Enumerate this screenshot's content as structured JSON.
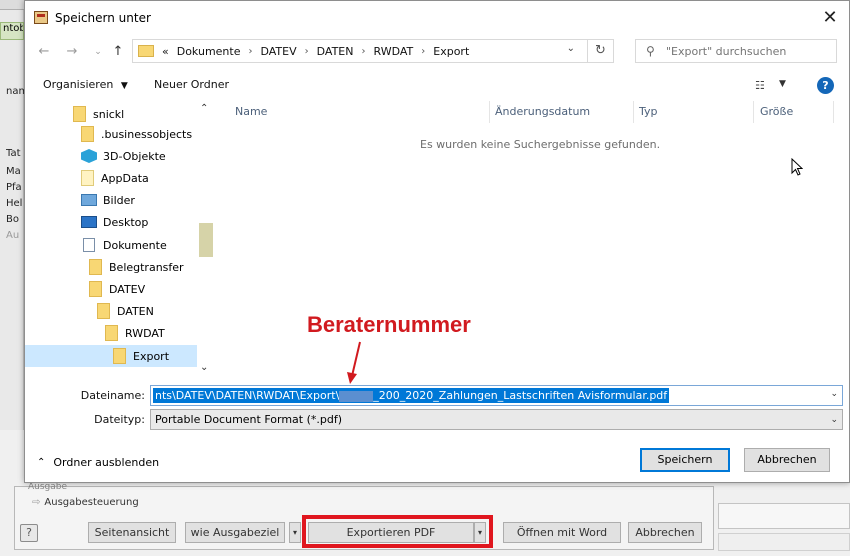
{
  "background": {
    "left_tab": "ntob",
    "left_labels": [
      "nam",
      "Tat",
      "Ma",
      "Pfa",
      "Hel",
      "Bo",
      "Au"
    ],
    "ausgabe_small": "Ausgabe",
    "ausgabesteuerung": "Ausgabesteuerung",
    "help_label": "?",
    "buttons": {
      "seitenansicht": "Seitenansicht",
      "wie_ausgabeziel": "wie Ausgabeziel",
      "exportieren_pdf": "Exportieren PDF",
      "oeffnen_mit_word": "Öffnen mit Word",
      "abbrechen": "Abbrechen"
    }
  },
  "dialog": {
    "title": "Speichern unter",
    "close_label": "✕",
    "address": {
      "prefix": "«",
      "crumbs": [
        "Dokumente",
        "DATEV",
        "DATEN",
        "RWDAT",
        "Export"
      ]
    },
    "search_placeholder": "\"Export\" durchsuchen",
    "toolbar": {
      "organisieren": "Organisieren",
      "neuer_ordner": "Neuer Ordner"
    },
    "tree": [
      {
        "label": "snickl"
      },
      {
        "label": ".businessobjects"
      },
      {
        "label": "3D-Objekte"
      },
      {
        "label": "AppData"
      },
      {
        "label": "Bilder"
      },
      {
        "label": "Desktop"
      },
      {
        "label": "Dokumente"
      },
      {
        "label": "Belegtransfer"
      },
      {
        "label": "DATEV"
      },
      {
        "label": "DATEN"
      },
      {
        "label": "RWDAT"
      },
      {
        "label": "Export"
      }
    ],
    "columns": [
      "Name",
      "Änderungsdatum",
      "Typ",
      "Größe"
    ],
    "empty_message": "Es wurden keine Suchergebnisse gefunden.",
    "filename_label": "Dateiname:",
    "filename_value_a": "nts\\DATEV\\DATEN\\RWDAT\\Export\\",
    "filename_value_b": "_200_2020_Zahlungen_Lastschriften Avisformular.pdf",
    "filetype_label": "Dateityp:",
    "filetype_value": "Portable Document Format (*.pdf)",
    "hide_folders": "Ordner ausblenden",
    "save_button": "Speichern",
    "cancel_button": "Abbrechen"
  },
  "annotation": {
    "text": "Beraternummer",
    "color": "#d11a1f"
  },
  "colors": {
    "selection": "#0078d7",
    "tree_selected": "#cce8ff",
    "highlight_box": "#e0161e",
    "help": "#1467b8"
  }
}
